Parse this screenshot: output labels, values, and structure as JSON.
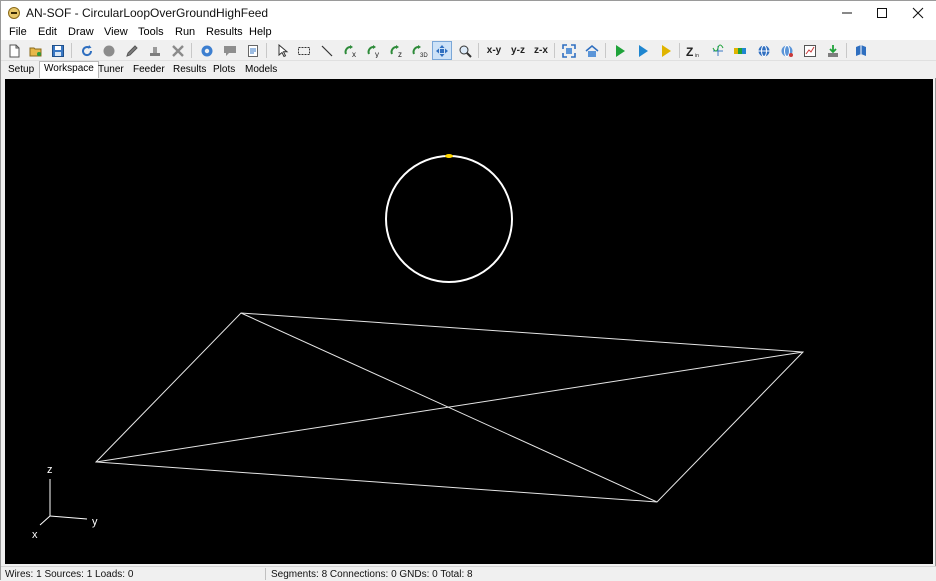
{
  "window": {
    "title": "AN-SOF - CircularLoopOverGroundHighFeed"
  },
  "menu": [
    {
      "label": "File"
    },
    {
      "label": "Edit"
    },
    {
      "label": "Draw"
    },
    {
      "label": "View"
    },
    {
      "label": "Tools"
    },
    {
      "label": "Run"
    },
    {
      "label": "Results"
    },
    {
      "label": "Help"
    }
  ],
  "toolbar": {
    "view_xy": "x-y",
    "view_yz": "y-z",
    "view_zx": "z-x"
  },
  "tabs": [
    {
      "label": "Setup"
    },
    {
      "label": "Workspace",
      "active": true
    },
    {
      "label": "Tuner"
    },
    {
      "label": "Feeder"
    },
    {
      "label": "Results"
    },
    {
      "label": "Plots"
    },
    {
      "label": "Models"
    }
  ],
  "workspace": {
    "background": "#000000",
    "wire_color": "#ffffff",
    "source_color": "#ffd700",
    "axes": {
      "x": "x",
      "y": "y",
      "z": "z"
    }
  },
  "status": {
    "left": "Wires: 1  Sources: 1  Loads: 0",
    "right": "Segments: 8  Connections: 0  GNDs: 0  Total: 8"
  }
}
